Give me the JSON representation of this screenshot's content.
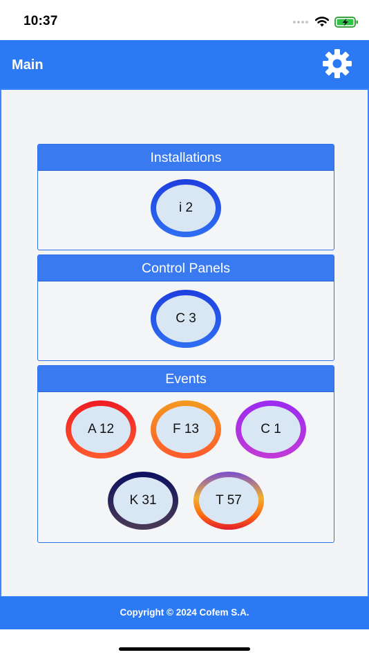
{
  "status_bar": {
    "time": "10:37",
    "icons": [
      "signal-dots-icon",
      "wifi-icon",
      "battery-charging-icon"
    ]
  },
  "header": {
    "title": "Main",
    "settings_icon": "gear-icon"
  },
  "cards": {
    "installations": {
      "title": "Installations",
      "badges": [
        {
          "label": "i 2",
          "color": "#2f6ff2"
        }
      ]
    },
    "control_panels": {
      "title": "Control Panels",
      "badges": [
        {
          "label": "C 3",
          "color": "#2f6ff2"
        }
      ]
    },
    "events": {
      "title": "Events",
      "badges": [
        {
          "label": "A 12",
          "color": "#ee1c24"
        },
        {
          "label": "F 13",
          "color": "#f39a1f"
        },
        {
          "label": "C 1",
          "color": "#9b2bf0"
        },
        {
          "label": "K 31",
          "color": "#0d1060"
        },
        {
          "label": "T 57",
          "color": "#ff6a10"
        }
      ]
    }
  },
  "footer": {
    "copyright": "Copyright © 2024 Cofem S.A."
  },
  "colors": {
    "brand_blue": "#2b7af3",
    "card_header": "#3a7af0",
    "background": "#f3f4f6"
  }
}
